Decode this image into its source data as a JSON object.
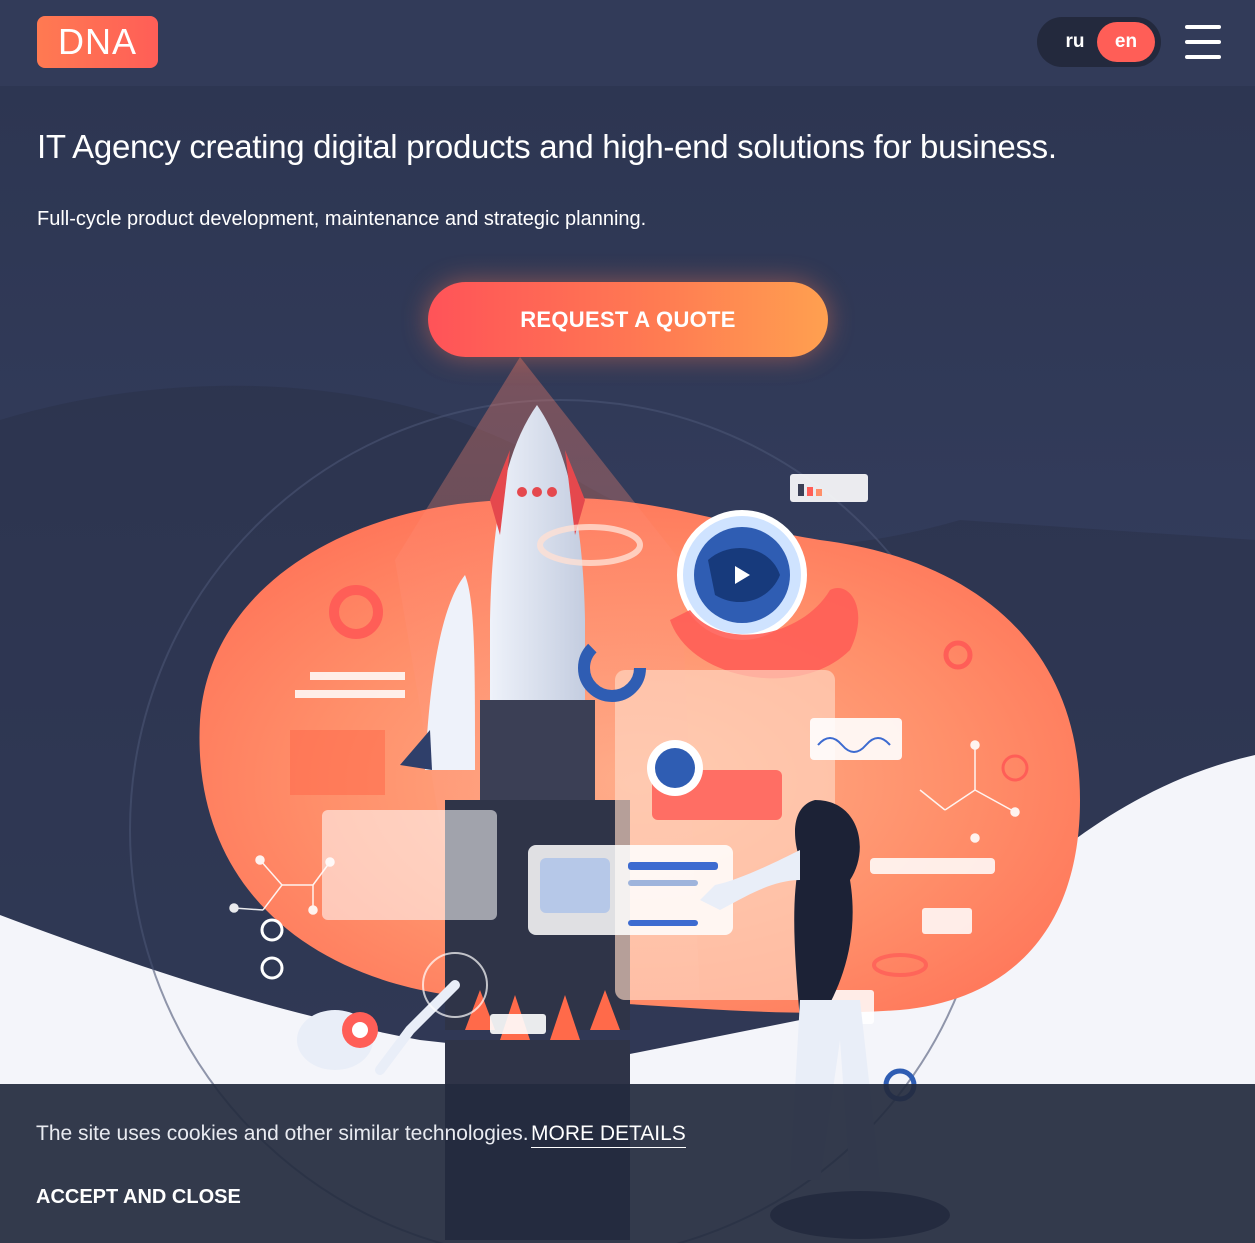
{
  "header": {
    "logo_text": "DNA",
    "languages": [
      {
        "code": "ru",
        "active": false
      },
      {
        "code": "en",
        "active": true
      }
    ],
    "menu_icon": "hamburger-icon"
  },
  "hero": {
    "title": "IT Agency creating digital products and high-end solutions for business.",
    "subtitle": "Full-cycle product development, maintenance and strategic planning.",
    "cta_label": "REQUEST A QUOTE"
  },
  "cookie_banner": {
    "text": "The site uses cookies and other similar technologies.",
    "link_label": "MORE DETAILS",
    "accept_label": "ACCEPT AND CLOSE"
  },
  "colors": {
    "background": "#323b59",
    "accent": "#ff5e57",
    "accent_gradient_end": "#ffa050",
    "cookie_bar": "#242b3e"
  }
}
